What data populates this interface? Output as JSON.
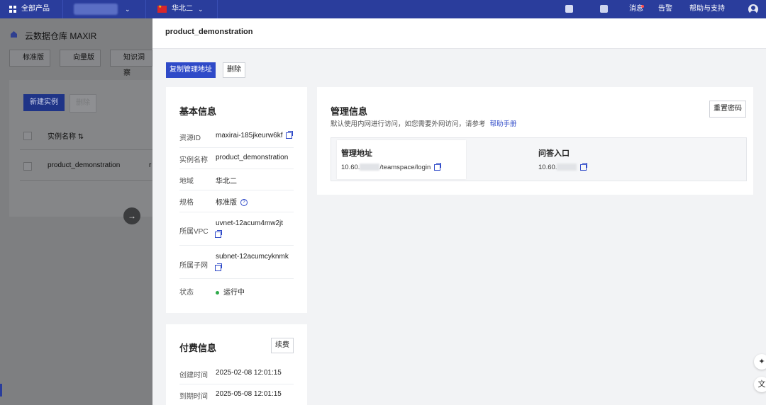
{
  "topnav": {
    "all_products": "全部产品",
    "region": "华北二",
    "messages": "消息",
    "alerts": "告警",
    "help": "帮助与支持"
  },
  "background": {
    "title": "云数据仓库 MAXIR",
    "tabs": [
      "标准版",
      "向量版",
      "知识洞察"
    ],
    "new_instance": "新建实例",
    "delete": "删除",
    "col_instance_name": "实例名称 ⇅",
    "row_instance": "product_demonstration",
    "row_suffix": "r"
  },
  "drawer": {
    "title": "product_demonstration",
    "copy_address_button": "复制管理地址",
    "delete_button": "删除",
    "basic": {
      "heading": "基本信息",
      "fields": [
        {
          "key": "资源ID",
          "value": "maxirai-185jkeurw6kf"
        },
        {
          "key": "实例名称",
          "value": "product_demonstration"
        },
        {
          "key": "地域",
          "value": "华北二"
        },
        {
          "key": "规格",
          "value": "标准版"
        },
        {
          "key": "所属VPC",
          "value": "uvnet-12acum4mw2jt"
        },
        {
          "key": "所属子网",
          "value": "subnet-12acumcyknmk"
        },
        {
          "key": "状态",
          "value": "运行中"
        }
      ]
    },
    "payment": {
      "heading": "付费信息",
      "renew_button": "续费",
      "fields": [
        {
          "key": "创建时间",
          "value": "2025-02-08 12:01:15"
        },
        {
          "key": "到期时间",
          "value": "2025-05-08 12:01:15"
        }
      ]
    },
    "management": {
      "heading": "管理信息",
      "subtitle": "默认使用内网进行访问，如您需要外网访问，请参考",
      "help_link": "帮助手册",
      "reset_password_button": "重置密码",
      "address_label": "管理地址",
      "address_prefix": "10.60.",
      "address_suffix": "/teamspace/login",
      "qa_label": "问答入口",
      "qa_prefix": "10.60."
    }
  },
  "floating": {
    "ai_icon": "✦",
    "translate_icon": "文"
  }
}
